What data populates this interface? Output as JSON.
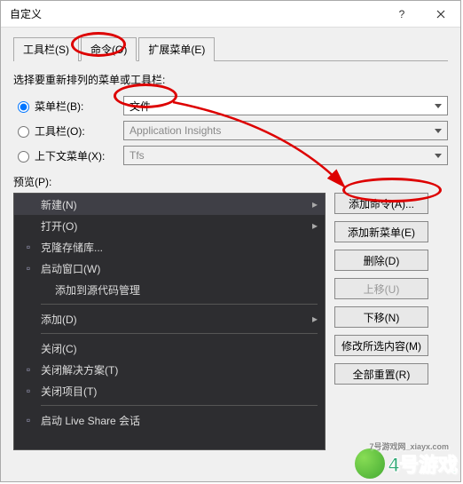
{
  "title": "自定义",
  "tabs": [
    "工具栏(S)",
    "命令(O)",
    "扩展菜单(E)"
  ],
  "active_tab": 1,
  "desc": "选择要重新排列的菜单或工具栏:",
  "radios": {
    "menubar": {
      "label": "菜单栏(B):",
      "value": "文件",
      "checked": true
    },
    "toolbar": {
      "label": "工具栏(O):",
      "value": "Application Insights",
      "checked": false
    },
    "context": {
      "label": "上下文菜单(X):",
      "value": "Tfs",
      "checked": false
    }
  },
  "preview_label": "预览(P):",
  "preview_items": [
    {
      "label": "新建(N)",
      "arrow": true,
      "selected": true
    },
    {
      "label": "打开(O)",
      "arrow": true
    },
    {
      "label": "克隆存储库...",
      "icon": "clone"
    },
    {
      "label": "启动窗口(W)",
      "icon": "window"
    },
    {
      "label": "添加到源代码管理",
      "sub": true
    },
    {
      "sep": true
    },
    {
      "label": "添加(D)",
      "arrow": true
    },
    {
      "sep": true
    },
    {
      "label": "关闭(C)"
    },
    {
      "label": "关闭解决方案(T)",
      "icon": "close-sol"
    },
    {
      "label": "关闭项目(T)",
      "icon": "close-proj"
    },
    {
      "sep": true
    },
    {
      "label": "启动 Live Share 会话",
      "icon": "live"
    }
  ],
  "buttons": {
    "add_cmd": "添加命令(A)...",
    "add_menu": "添加新菜单(E)",
    "delete": "删除(D)",
    "move_up": "上移(U)",
    "move_down": "下移(N)",
    "modify": "修改所选内容(M)",
    "reset": "全部重置(R)"
  },
  "watermark": {
    "site": "7号游戏网_xiayx.com",
    "brand": "4号游戏"
  }
}
